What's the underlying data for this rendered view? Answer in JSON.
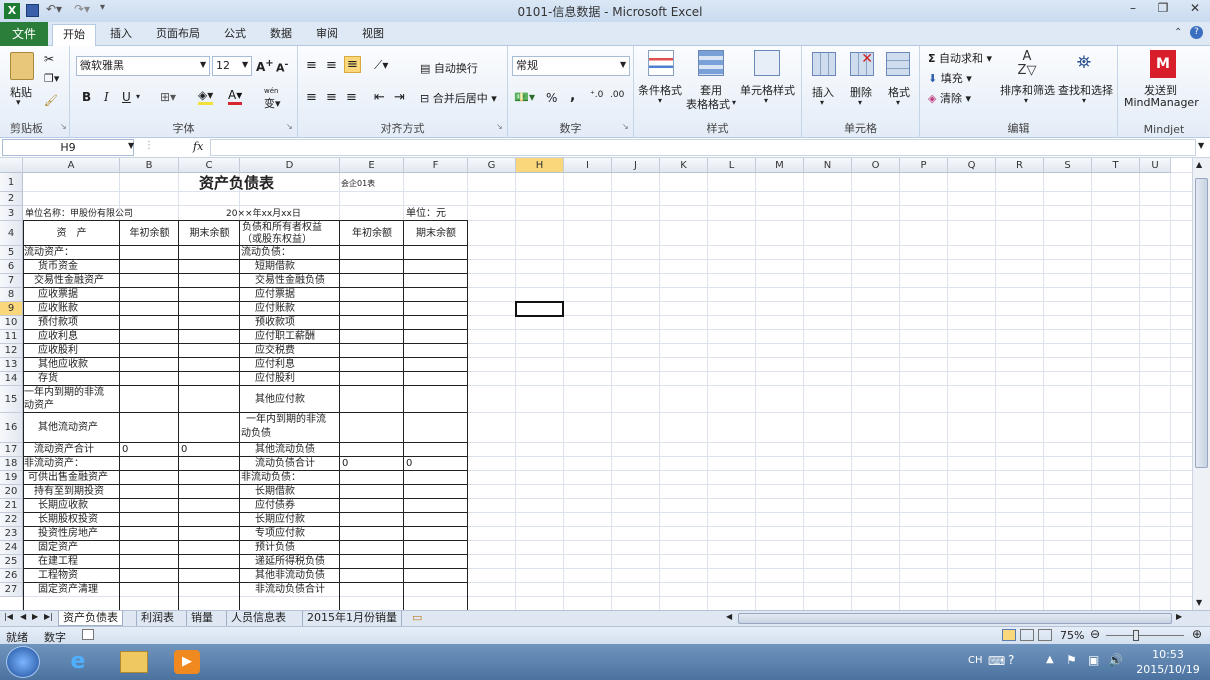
{
  "window": {
    "title": "0101-信息数据 - Microsoft Excel"
  },
  "tabs": {
    "file": "文件",
    "home": "开始",
    "insert": "插入",
    "layout": "页面布局",
    "formulas": "公式",
    "data": "数据",
    "review": "审阅",
    "view": "视图"
  },
  "ribbon": {
    "clipboard": {
      "label": "剪贴板",
      "paste": "粘贴"
    },
    "font": {
      "label": "字体",
      "name": "微软雅黑",
      "size": "12",
      "bold": "B",
      "italic": "I",
      "underline": "U",
      "phonetic": "wén",
      "ruby": "变"
    },
    "alignment": {
      "label": "对齐方式",
      "wrap": "自动换行",
      "merge": "合并后居中"
    },
    "number": {
      "label": "数字",
      "format": "常规",
      "percent": "%",
      "comma": ","
    },
    "styles": {
      "label": "样式",
      "cond": "条件格式",
      "table_line1": "套用",
      "table_line2": "表格格式",
      "cell": "单元格样式"
    },
    "cells": {
      "label": "单元格",
      "insert": "插入",
      "delete": "删除",
      "format": "格式"
    },
    "editing": {
      "label": "编辑",
      "autosum": "自动求和",
      "fill": "填充",
      "clear": "清除",
      "sort": "排序和筛选",
      "find": "查找和选择",
      "sigma": "Σ"
    },
    "mindjet": {
      "label": "Mindjet",
      "send_line1": "发送到",
      "send_line2": "MindManager"
    }
  },
  "formula": {
    "namebox": "H9",
    "fx": "fx",
    "value": ""
  },
  "columns": [
    "A",
    "B",
    "C",
    "D",
    "E",
    "F",
    "G",
    "H",
    "I",
    "J",
    "K",
    "L",
    "M",
    "N",
    "O",
    "P",
    "Q",
    "R",
    "S",
    "T",
    "U"
  ],
  "rows": [
    "1",
    "2",
    "3",
    "4",
    "5",
    "6",
    "7",
    "8",
    "9",
    "10",
    "11",
    "12",
    "13",
    "14",
    "15",
    "16",
    "17",
    "18",
    "19",
    "20",
    "21",
    "22",
    "23",
    "24",
    "25",
    "26",
    "27"
  ],
  "sheet": {
    "title": "资产负债表",
    "form_no": "会企01表",
    "company": "单位名称：甲股份有限公司",
    "date": "20××年xx月xx日",
    "unit": "单位：元",
    "head_asset": "资　产",
    "head_begin": "年初余额",
    "head_end": "期末余额",
    "head_liab1": "负债和所有者权益",
    "head_liab2": "（或股东权益）",
    "head_begin2": "年初余额",
    "head_end2": "期末余额",
    "assets": [
      "流动资产：",
      "货币资金",
      "交易性金融资产",
      "应收票据",
      "应收账款",
      "预付款项",
      "应收利息",
      "应收股利",
      "其他应收款",
      "存货",
      "一年内到期的非流",
      "其他流动资产",
      "流动资产合计",
      "非流动资产：",
      "可供出售金融资产",
      "持有至到期投资",
      "长期应收款",
      "长期股权投资",
      "投资性房地产",
      "固定资产",
      "在建工程",
      "工程物资",
      "固定资产清理"
    ],
    "asset15b": "动资产",
    "liabs": [
      "流动负债：",
      "短期借款",
      "交易性金融负债",
      "应付票据",
      "应付账款",
      "预收款项",
      "应付职工薪酬",
      "应交税费",
      "应付利息",
      "应付股利",
      "其他应付款",
      "一年内到期的非流",
      "其他流动负债",
      "流动负债合计",
      "非流动负债：",
      "长期借款",
      "应付债券",
      "长期应付款",
      "专项应付款",
      "预计负债",
      "递延所得税负债",
      "其他非流动负债",
      "非流动负债合计"
    ],
    "liab16b": "动负债",
    "b17": "0",
    "c17": "0",
    "e18": "0",
    "f18": "0"
  },
  "sheettabs": [
    "资产负债表",
    "利润表",
    "销量",
    "人员信息表",
    "2015年1月份销量"
  ],
  "status": {
    "ready": "就绪",
    "num": "数字",
    "zoom": "75%"
  },
  "taskbar": {
    "lang": "CH",
    "time": "10:53",
    "date": "2015/10/19"
  }
}
